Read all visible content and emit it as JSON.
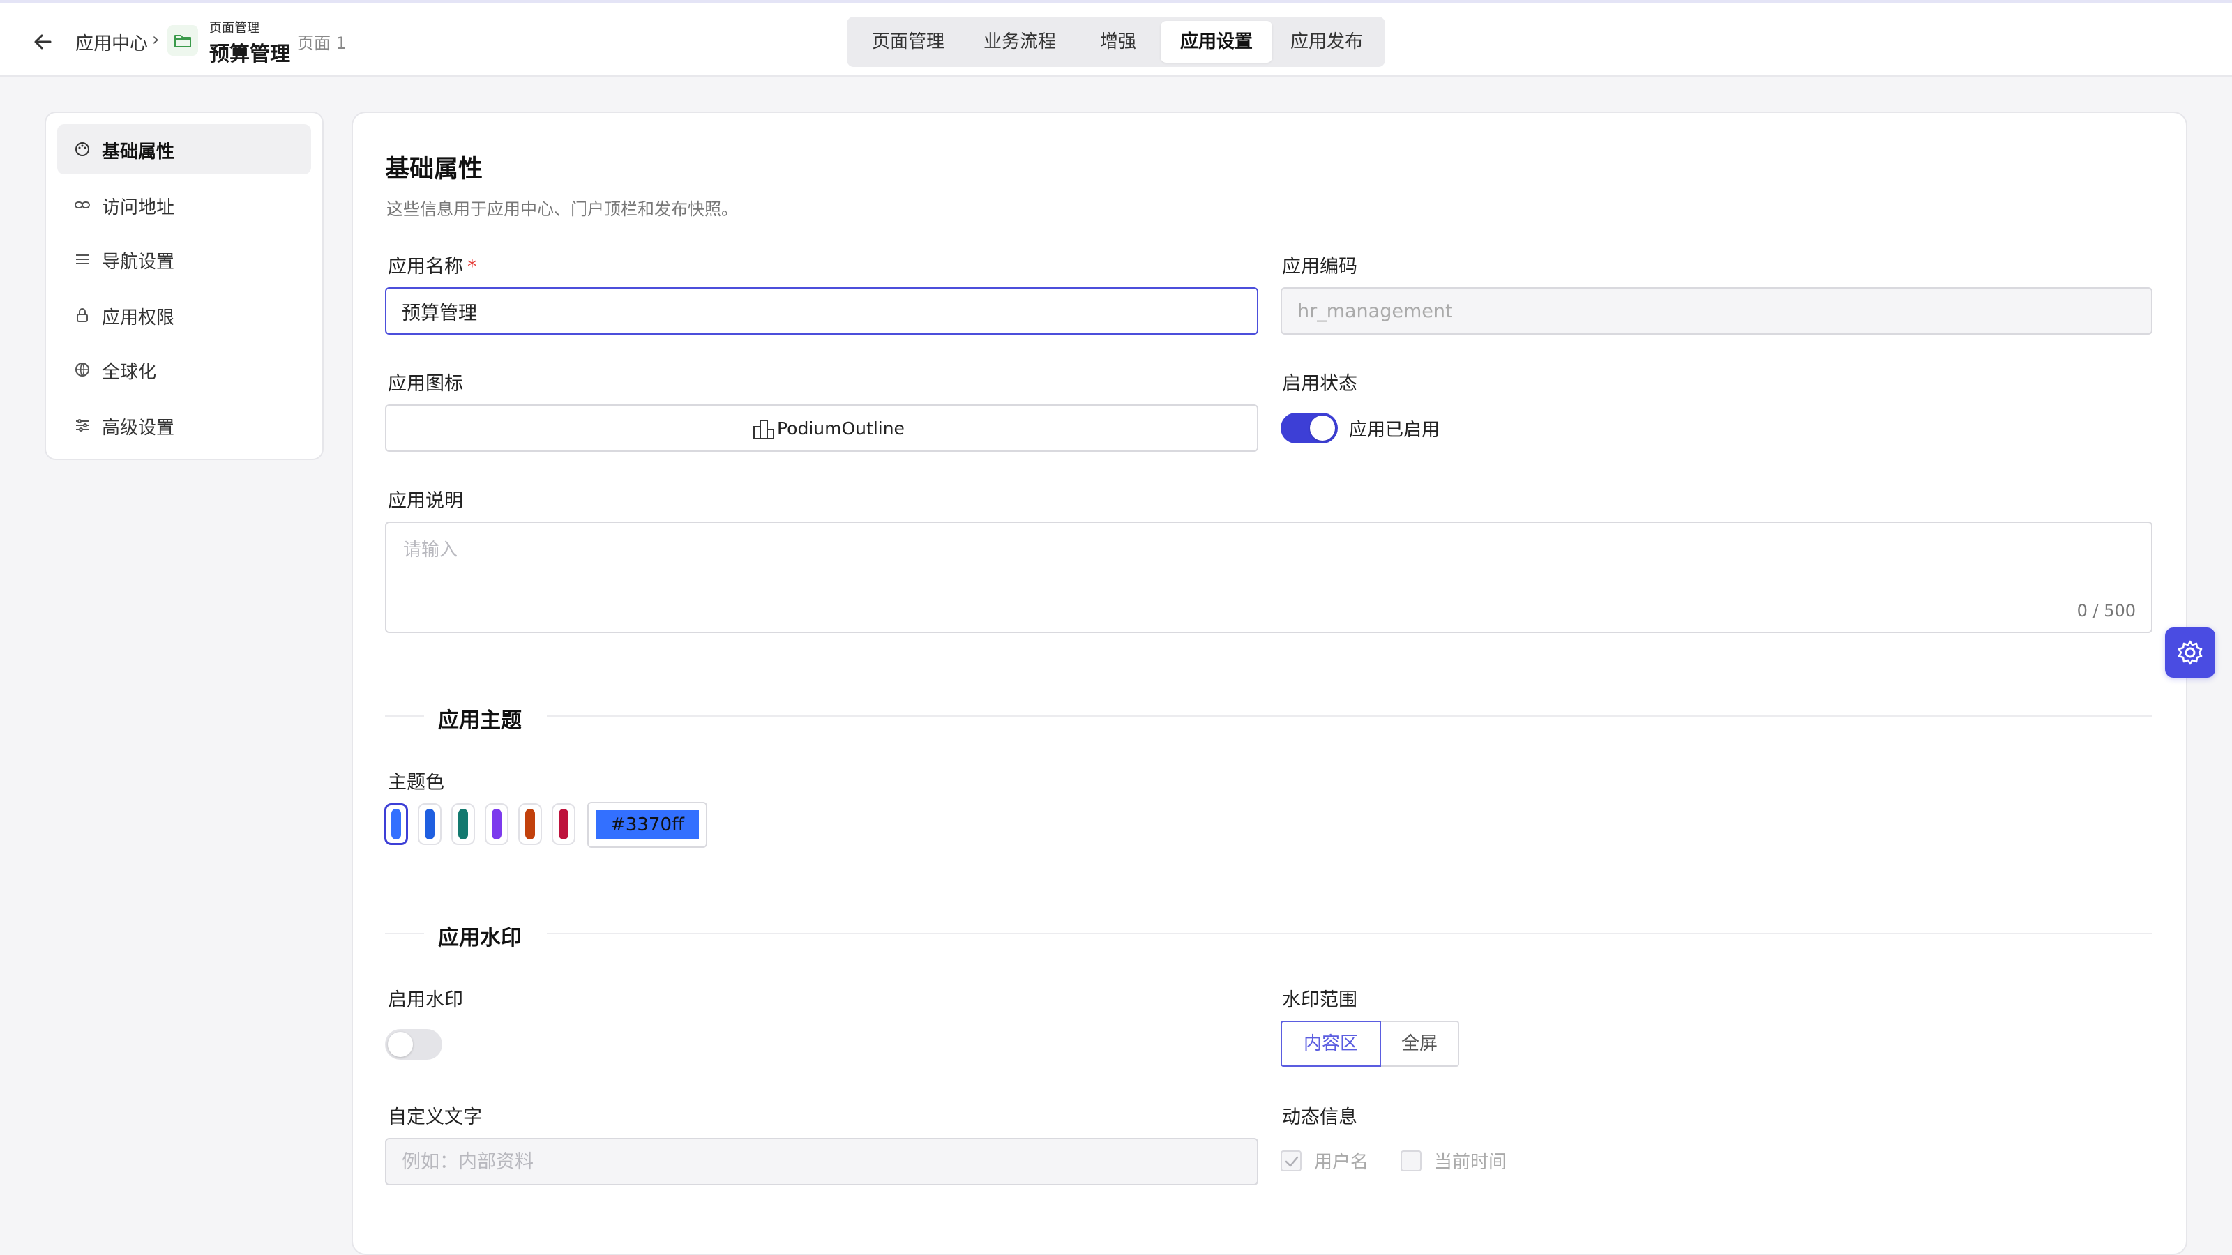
{
  "header": {
    "breadcrumb_root": "应用中心",
    "breadcrumb_sep": "›",
    "breadcrumb_parent": "页面管理",
    "breadcrumb_current": "预算管理",
    "page_label": "页面 1",
    "tabs": [
      {
        "label": "页面管理"
      },
      {
        "label": "业务流程"
      },
      {
        "label": "增强"
      },
      {
        "label": "应用设置"
      },
      {
        "label": "应用发布"
      }
    ],
    "active_tab": "应用设置"
  },
  "sidebar": {
    "items": [
      {
        "label": "基础属性",
        "icon": "palette-icon"
      },
      {
        "label": "访问地址",
        "icon": "link-icon"
      },
      {
        "label": "导航设置",
        "icon": "menu-icon"
      },
      {
        "label": "应用权限",
        "icon": "lock-icon"
      },
      {
        "label": "全球化",
        "icon": "globe-icon"
      },
      {
        "label": "高级设置",
        "icon": "sliders-icon"
      }
    ],
    "active": "基础属性"
  },
  "basic": {
    "title": "基础属性",
    "description": "这些信息用于应用中心、门户顶栏和发布快照。",
    "app_name_label": "应用名称",
    "required_mark": "*",
    "app_name_value": "预算管理",
    "app_code_label": "应用编码",
    "app_code_value": "hr_management",
    "app_icon_label": "应用图标",
    "app_icon_value": "PodiumOutline",
    "status_label": "启用状态",
    "status_text": "应用已启用",
    "status_on": true,
    "desc_label": "应用说明",
    "desc_placeholder": "请输入",
    "desc_counter": "0 / 500"
  },
  "theme": {
    "section_title": "应用主题",
    "color_label": "主题色",
    "colors": [
      "#3370ff",
      "#1f5fe0",
      "#13796f",
      "#7c3aed",
      "#c2410c",
      "#be123c"
    ],
    "selected_color": "#3370ff",
    "hex_value": "#3370ff"
  },
  "watermark": {
    "section_title": "应用水印",
    "enable_label": "启用水印",
    "enabled": false,
    "scope_label": "水印范围",
    "scope_options": [
      "内容区",
      "全屏"
    ],
    "scope_selected": "内容区",
    "custom_text_label": "自定义文字",
    "custom_text_placeholder": "例如：内部资料",
    "dynamic_label": "动态信息",
    "dynamic_options": [
      {
        "label": "用户名",
        "checked": true
      },
      {
        "label": "当前时间",
        "checked": false
      }
    ]
  },
  "colors": {
    "accent": "#3d3fd6",
    "fab": "#4a4ce2"
  }
}
